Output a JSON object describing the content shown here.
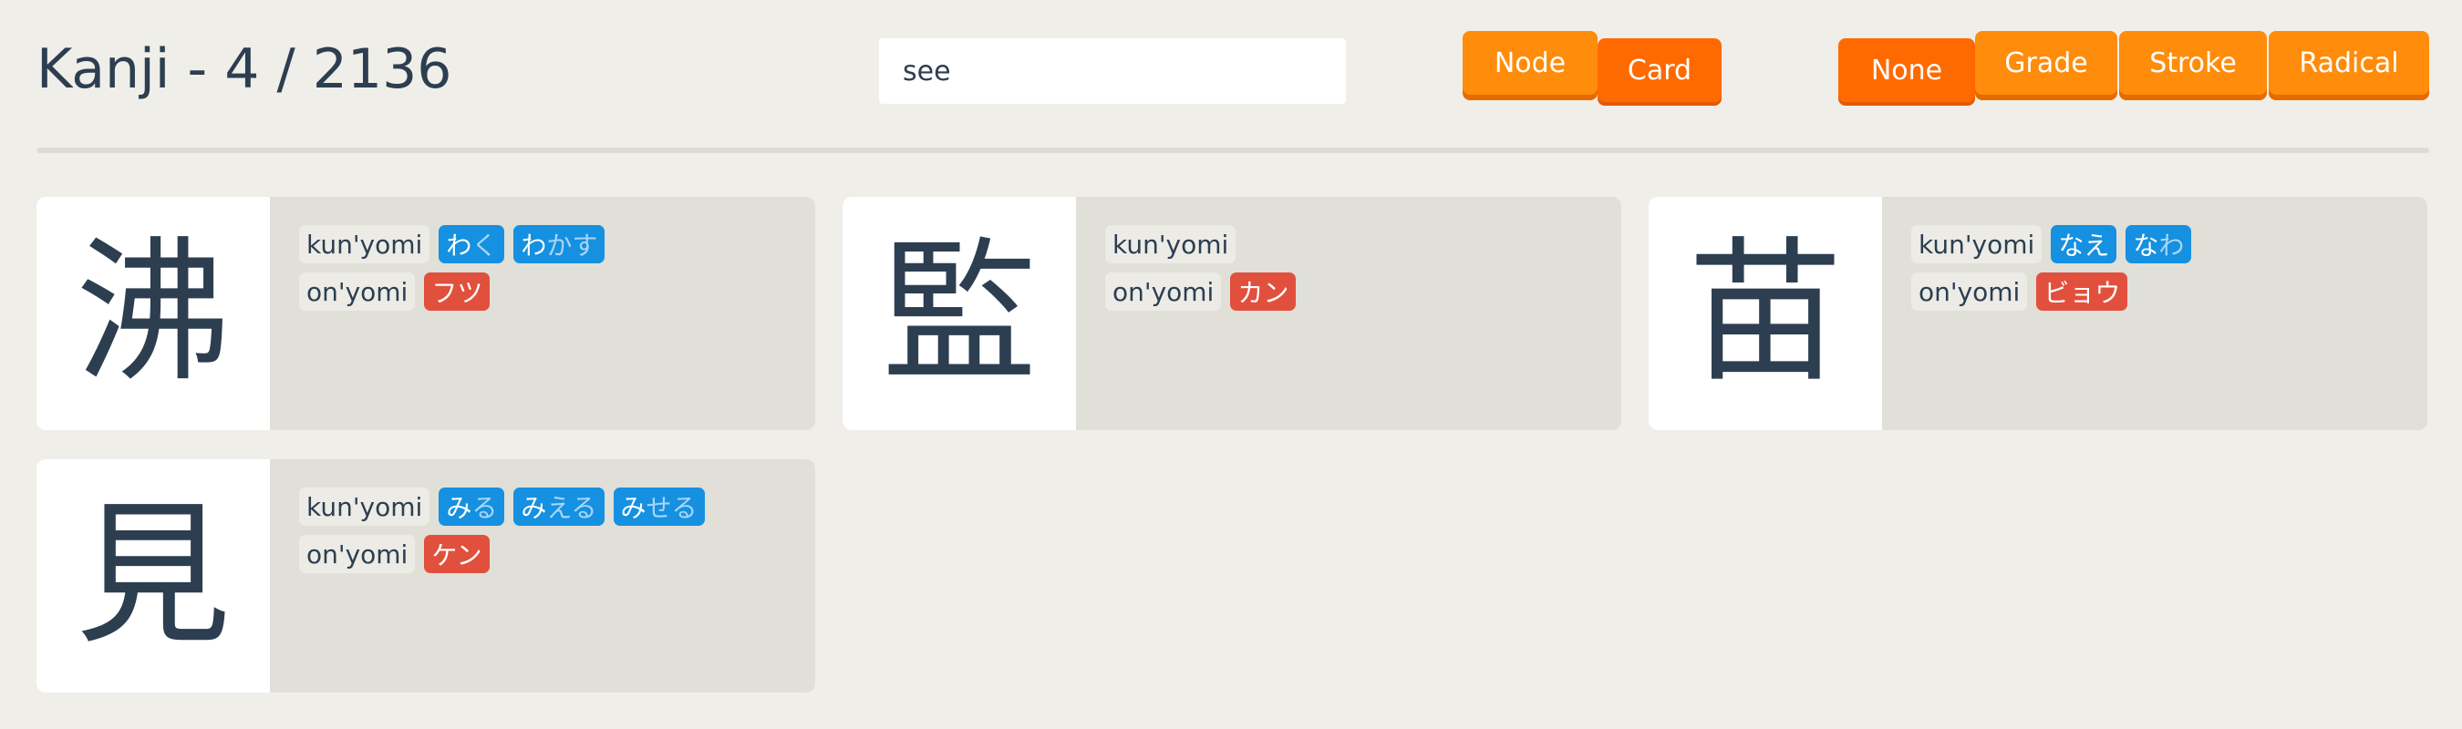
{
  "header": {
    "title": "Kanji - 4 / 2136"
  },
  "search": {
    "value": "see",
    "placeholder": ""
  },
  "view_toggle": {
    "buttons": [
      {
        "label": "Node",
        "active": false
      },
      {
        "label": "Card",
        "active": true
      }
    ]
  },
  "sort_toggle": {
    "buttons": [
      {
        "label": "None",
        "active": true
      },
      {
        "label": "Grade",
        "active": false
      },
      {
        "label": "Stroke",
        "active": false
      },
      {
        "label": "Radical",
        "active": false
      }
    ]
  },
  "labels": {
    "kunyomi": "kun'yomi",
    "onyomi": "on'yomi"
  },
  "cards": [
    {
      "kanji": "沸",
      "kunyomi": [
        {
          "stem": "わ",
          "okurigana": "く"
        },
        {
          "stem": "わ",
          "okurigana": "かす"
        }
      ],
      "onyomi": [
        "フツ"
      ]
    },
    {
      "kanji": "監",
      "kunyomi": [],
      "onyomi": [
        "カン"
      ]
    },
    {
      "kanji": "苗",
      "kunyomi": [
        {
          "stem": "なえ",
          "okurigana": ""
        },
        {
          "stem": "な",
          "okurigana": "わ"
        }
      ],
      "onyomi": [
        "ビョウ"
      ]
    },
    {
      "kanji": "見",
      "kunyomi": [
        {
          "stem": "み",
          "okurigana": "る"
        },
        {
          "stem": "み",
          "okurigana": "える"
        },
        {
          "stem": "み",
          "okurigana": "せる"
        }
      ],
      "onyomi": [
        "ケン"
      ]
    }
  ],
  "colors": {
    "background": "#efeee8",
    "accent_orange": "#ff8c0a",
    "kunyomi_blue": "#1690e0",
    "onyomi_red": "#e1503c",
    "text_dark": "#2c3e50"
  }
}
